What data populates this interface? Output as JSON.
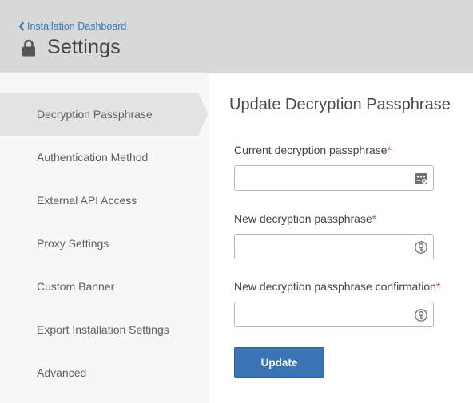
{
  "header": {
    "back_link": "Installation Dashboard",
    "title": "Settings"
  },
  "sidebar": {
    "items": [
      {
        "label": "Decryption Passphrase",
        "active": true
      },
      {
        "label": "Authentication Method",
        "active": false
      },
      {
        "label": "External API Access",
        "active": false
      },
      {
        "label": "Proxy Settings",
        "active": false
      },
      {
        "label": "Custom Banner",
        "active": false
      },
      {
        "label": "Export Installation Settings",
        "active": false
      },
      {
        "label": "Advanced",
        "active": false
      }
    ]
  },
  "main": {
    "title": "Update Decryption Passphrase",
    "fields": [
      {
        "label": "Current decryption passphrase",
        "required_mark": "*",
        "value": "",
        "icon": "password-manager-icon"
      },
      {
        "label": "New decryption passphrase",
        "required_mark": "*",
        "value": "",
        "icon": "key-icon"
      },
      {
        "label": "New decryption passphrase confirmation",
        "required_mark": "*",
        "value": "",
        "icon": "key-icon"
      }
    ],
    "submit_label": "Update"
  },
  "colors": {
    "header_bg": "#d8d8d8",
    "link": "#2e7bbf",
    "button": "#3a74b5",
    "required": "#d9534f",
    "sidebar_active": "#e3e3e3"
  }
}
